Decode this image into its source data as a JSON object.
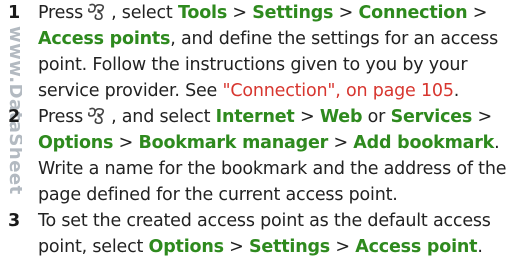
{
  "watermark": "www.DataSheet",
  "icons": {
    "menu_key": "menu-key-icon"
  },
  "colors": {
    "ui_green": "#2e8a1e",
    "link_red": "#d7362f",
    "text": "#222222"
  },
  "steps": [
    {
      "number": "1",
      "press": "Press",
      "t1": ", select",
      "tools": "Tools",
      "sep1": ">",
      "settings": "Settings",
      "sep2": ">",
      "connection": "Connection",
      "sep3": ">",
      "access_points": "Access points",
      "t2": ", and define the settings for an access",
      "t3": "point. Follow the instructions given to you by your",
      "t4": "service provider. See",
      "link": "\"Connection\", on page 105",
      "t5": "."
    },
    {
      "number": "2",
      "press": "Press",
      "t1": ", and select",
      "internet": "Internet",
      "sep1": ">",
      "web": "Web",
      "or": "or",
      "services": "Services",
      "sep2": ">",
      "options": "Options",
      "sep3": ">",
      "bookmark_manager": "Bookmark manager",
      "sep4": ">",
      "add_bookmark": "Add bookmark",
      "t2": ".",
      "t3": "Write a name for the bookmark and the address of the",
      "t4": "page defined for the current access point."
    },
    {
      "number": "3",
      "t1": "To set the created access point as the default access",
      "t2": "point, select",
      "options": "Options",
      "sep1": ">",
      "settings": "Settings",
      "sep2": ">",
      "access_point": "Access point",
      "t3": "."
    }
  ]
}
